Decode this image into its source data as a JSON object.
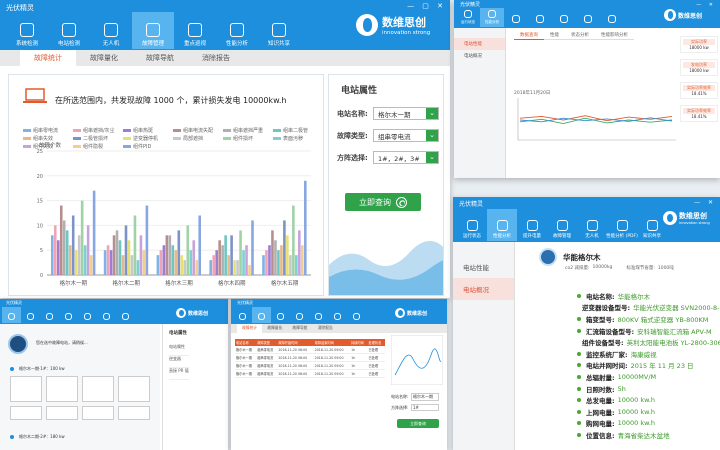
{
  "w1": {
    "title": "光伏精灵",
    "tabs": [
      "系统检测",
      "电站检测",
      "无人机",
      "故障管理",
      "重点巡视",
      "性能分析",
      "知识共享"
    ],
    "brand_cn": "数维思创",
    "brand_en": "innovation strong",
    "subtabs": [
      "故障统计",
      "故障量化",
      "故障导航",
      "消除报告"
    ],
    "stat_text": "在所选范围内，共发现故障 1000 个，累计损失发电 10000kw.h",
    "y_label": "故障个数",
    "prop_title": "电站属性",
    "form": [
      {
        "label": "电站名称:",
        "value": "格尔木一期"
      },
      {
        "label": "故障类型:",
        "value": "组串零电流"
      },
      {
        "label": "方阵选择:",
        "value": "1#，2#，3#"
      }
    ],
    "query_btn": "立即查询",
    "search_icon": "magnifier-icon"
  },
  "w2": {
    "title": "光伏精灵",
    "tabs": [
      "运行状态",
      "性能分析",
      "",
      "",
      "",
      "",
      ""
    ],
    "brand_cn": "数维思创",
    "tab_labels": [
      "数据查询",
      "性能",
      "状态分析",
      "性能影响分析"
    ],
    "side": [
      "电站性能",
      "电站概况"
    ],
    "date_label": "2018年11月20日",
    "alerts": [
      {
        "label": "实际功率",
        "value": "18000 kw"
      },
      {
        "label": "发电功率",
        "value": "18000 kw"
      },
      {
        "label": "实际功率效率",
        "value": "18.41%"
      },
      {
        "label": "实际功率效率",
        "value": "18.41%"
      }
    ]
  },
  "w3": {
    "title": "光伏精灵",
    "tabs": [
      "运行状态",
      "性能分析",
      "提升电量",
      "故障管理",
      "无人机",
      "性能分析 (PDF)",
      "知识共享"
    ],
    "brand_cn": "数维思创",
    "brand_en": "innovation strong",
    "side": [
      "电站性能",
      "电站概况"
    ],
    "station": "华能格尔木",
    "meta": [
      {
        "label": "co2 减排量:",
        "value": "10000kg"
      },
      {
        "label": "标准煤节省量:",
        "value": "1000吨"
      }
    ],
    "details": [
      {
        "label": "电站名称:",
        "value": "华能格尔木"
      },
      {
        "label": "逆变器设备型号:",
        "value": "华能光伏逆变器 SVN2000-8-20kW"
      },
      {
        "label": "箱变型号:",
        "value": "800KV 箱式逆变器 YB-800KM"
      },
      {
        "label": "汇流箱设备型号:",
        "value": "安科瑞智能汇流箱 APV-M"
      },
      {
        "label": "组件设备型号:",
        "value": "英利太阳能电池板 YL-2800-306"
      },
      {
        "label": "监控系统厂家:",
        "value": "海康威视"
      },
      {
        "label": "电站并网时间:",
        "value": "2015 年 11 月 23 日"
      },
      {
        "label": "总辐射量:",
        "value": "10000MV/M"
      },
      {
        "label": "日照时数:",
        "value": "5h"
      },
      {
        "label": "总发电量:",
        "value": "10000 kw.h"
      },
      {
        "label": "上网电量:",
        "value": "10000 kw.h"
      },
      {
        "label": "购网电量:",
        "value": "10000 kw.h"
      },
      {
        "label": "位置信息:",
        "value": "青海省柴达木盆地"
      }
    ]
  },
  "w4": {
    "title": "光伏精灵",
    "brand_cn": "数维思创",
    "status_text": "您在选中故障电站，请稍候...",
    "stations": [
      {
        "label": "格尔木一期·1#：100 kw"
      },
      {
        "label": "格尔木二期·2#：180 kw"
      }
    ],
    "right_title": "电站属性",
    "right_items": [
      "电站属性",
      "逆变器",
      "直接 PR 值"
    ]
  },
  "w5": {
    "title": "光伏精灵",
    "brand_cn": "数维思创",
    "tabs": [
      "故障统计",
      "故障量化",
      "故障导航",
      "消除报告"
    ],
    "table_headers": [
      "电站名称",
      "故障类型",
      "故障开始时间",
      "故障结束时间",
      "持续时间",
      "处理状态"
    ],
    "table_rows": [
      [
        "格尔木一期",
        "组串零电流",
        "2018-11-20 08:00",
        "2018-11-20 09:00",
        "1h",
        "已处理"
      ],
      [
        "格尔木一期",
        "组串零电流",
        "2018-11-20 08:00",
        "2018-11-20 09:00",
        "1h",
        "已处理"
      ],
      [
        "格尔木一期",
        "组串零电流",
        "2018-11-20 08:00",
        "2018-11-20 09:00",
        "1h",
        "已处理"
      ],
      [
        "格尔木一期",
        "组串零电流",
        "2018-11-20 08:00",
        "2018-11-20 09:00",
        "1h",
        "已处理"
      ]
    ],
    "form_labels": [
      "电站名称:",
      "方阵选择:"
    ],
    "form_values": [
      "格尔木一期",
      "1#"
    ],
    "query_btn": "立即查询"
  },
  "chart_data": {
    "type": "bar",
    "title": "",
    "ylabel": "故障个数",
    "ylim": [
      0,
      25
    ],
    "yticks": [
      0,
      5,
      10,
      15,
      20,
      25
    ],
    "categories": [
      "格尔木一期",
      "格尔木二期",
      "格尔木三期",
      "格尔木四期",
      "格尔木五期"
    ],
    "series": [
      {
        "name": "组串零电流",
        "color": "#7fb2e5",
        "values": [
          8,
          5,
          4,
          3,
          4
        ]
      },
      {
        "name": "组串遮挡/灰尘",
        "color": "#f0a2b7",
        "values": [
          10,
          6,
          5,
          4,
          5
        ]
      },
      {
        "name": "组串热斑",
        "color": "#9d7cd1",
        "values": [
          7,
          5,
          6,
          5,
          6
        ]
      },
      {
        "name": "组串电流失配",
        "color": "#b78e8e",
        "values": [
          14,
          8,
          8,
          7,
          9
        ]
      },
      {
        "name": "组串遮挡严重",
        "color": "#b0b0b0",
        "values": [
          11,
          9,
          8,
          6,
          7
        ]
      },
      {
        "name": "组串二极管",
        "color": "#6dc6c2",
        "values": [
          9,
          7,
          6,
          8,
          5
        ]
      },
      {
        "name": "组串失效",
        "color": "#e5b98a",
        "values": [
          6,
          4,
          5,
          4,
          6
        ]
      },
      {
        "name": "二极管损坏",
        "color": "#7b93c9",
        "values": [
          12,
          10,
          9,
          8,
          11
        ]
      },
      {
        "name": "逆变器停机",
        "color": "#e7e072",
        "values": [
          5,
          7,
          4,
          3,
          8
        ]
      },
      {
        "name": "局部遮挡",
        "color": "#c8c8c8",
        "values": [
          8,
          4,
          3,
          3,
          4
        ]
      },
      {
        "name": "组件损坏",
        "color": "#9fd3a6",
        "values": [
          15,
          12,
          10,
          9,
          14
        ]
      },
      {
        "name": "表面污秽",
        "color": "#7ccfd3",
        "values": [
          6,
          3,
          5,
          5,
          4
        ]
      },
      {
        "name": "组件失效",
        "color": "#c9a2d8",
        "values": [
          10,
          8,
          7,
          6,
          9
        ]
      },
      {
        "name": "组件隐裂",
        "color": "#f3ce8c",
        "values": [
          4,
          5,
          3,
          2,
          6
        ]
      },
      {
        "name": "组件PID",
        "color": "#88a6e2",
        "values": [
          17,
          14,
          12,
          11,
          19
        ]
      }
    ]
  },
  "line_data": {
    "type": "line",
    "series": [
      {
        "color": "#e25b2d",
        "values": [
          0.55,
          0.6,
          0.5,
          0.62,
          0.48,
          0.58,
          0.52,
          0.6
        ]
      },
      {
        "color": "#3aa96b",
        "values": [
          0.45,
          0.52,
          0.4,
          0.55,
          0.42,
          0.5,
          0.44,
          0.5
        ]
      },
      {
        "color": "#3b8fd6",
        "values": [
          0.5,
          0.45,
          0.55,
          0.48,
          0.53,
          0.46,
          0.56,
          0.47
        ]
      }
    ]
  }
}
